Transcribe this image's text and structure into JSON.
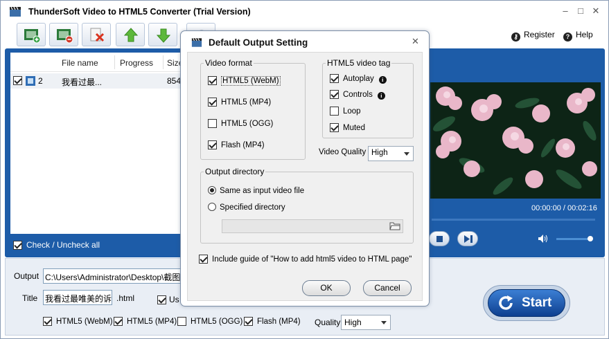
{
  "app": {
    "title": "ThunderSoft Video to HTML5 Converter (Trial Version)",
    "register": "Register",
    "help": "Help",
    "accent_blue": "#1d5ca8"
  },
  "toolbar": {
    "items": [
      "add-video-icon",
      "remove-video-icon",
      "delete-icon",
      "move-up-icon",
      "move-down-icon",
      "settings-icon"
    ]
  },
  "file_list": {
    "columns": [
      "File name",
      "Progress",
      "Size"
    ],
    "rows": [
      {
        "checked": true,
        "index": "2",
        "name": "我看过最...",
        "progress": "",
        "size": "854"
      }
    ],
    "check_all": "Check / Uncheck all"
  },
  "player": {
    "time": "00:00:00 / 00:02:16"
  },
  "bottom": {
    "output_label": "Output",
    "output_value": "C:\\Users\\Administrator\\Desktop\\截图\\测",
    "title_label": "Title",
    "title_value": "我看过最唯美的诉",
    "title_ext": ".html",
    "use_label": "Us",
    "formats": [
      {
        "label": "HTML5 (WebM)",
        "checked": true
      },
      {
        "label": "HTML5 (MP4)",
        "checked": true
      },
      {
        "label": "HTML5 (OGG)",
        "checked": false
      },
      {
        "label": "Flash (MP4)",
        "checked": true
      }
    ],
    "quality_label": "Quality",
    "quality_value": "High",
    "start": "Start"
  },
  "dialog": {
    "title": "Default Output Setting",
    "video_format": {
      "title": "Video format",
      "options": [
        {
          "label": "HTML5 (WebM)",
          "checked": true
        },
        {
          "label": "HTML5 (MP4)",
          "checked": true
        },
        {
          "label": "HTML5 (OGG)",
          "checked": false
        },
        {
          "label": "Flash (MP4)",
          "checked": true
        }
      ]
    },
    "video_tag": {
      "title": "HTML5 video tag",
      "options": [
        {
          "label": "Autoplay",
          "checked": true,
          "info": true
        },
        {
          "label": "Controls",
          "checked": true,
          "info": true
        },
        {
          "label": "Loop",
          "checked": false,
          "info": false
        },
        {
          "label": "Muted",
          "checked": true,
          "info": false
        }
      ]
    },
    "quality_label": "Video Quality",
    "quality_value": "High",
    "output_dir": {
      "title": "Output directory",
      "same_as_input": "Same as input video file",
      "specified": "Specified directory",
      "path": ""
    },
    "guide_label": "Include guide of \"How to add html5 video to HTML page\"",
    "guide_checked": true,
    "ok": "OK",
    "cancel": "Cancel"
  }
}
